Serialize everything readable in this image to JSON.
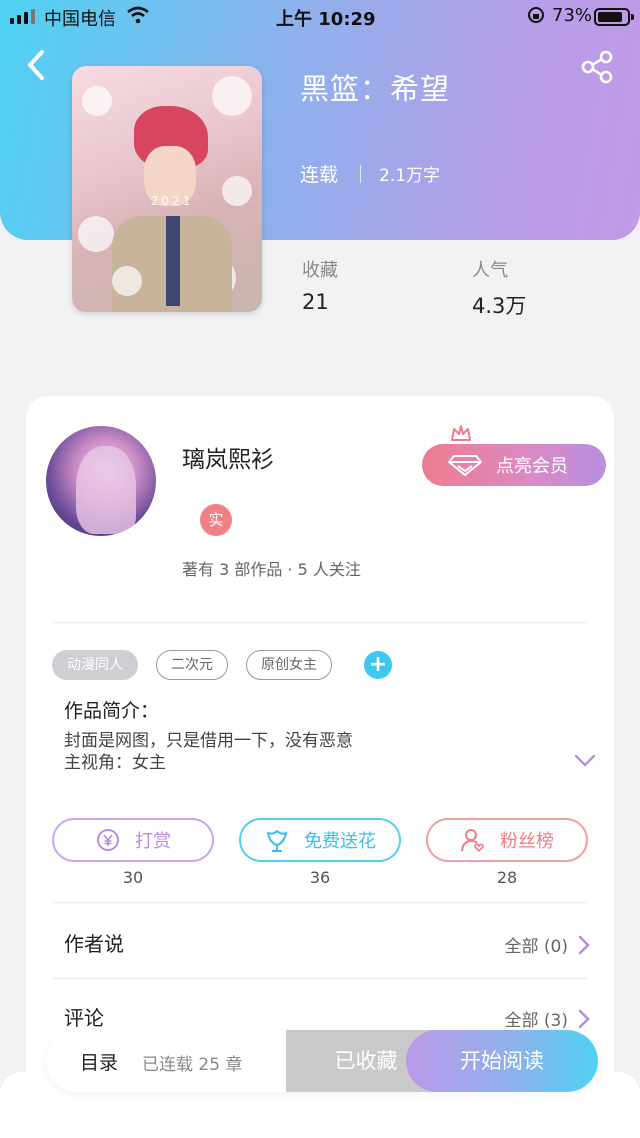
{
  "status_bar": {
    "carrier": "中国电信",
    "time": "上午 10:29",
    "battery": "73%"
  },
  "book": {
    "title": "黑篮：希望",
    "state": "连载",
    "words": "2.1万字",
    "cover_watermark": "2021",
    "stats": [
      {
        "label": "收藏",
        "value": "21"
      },
      {
        "label": "人气",
        "value": "4.3万"
      }
    ]
  },
  "author": {
    "name": "璃岚熙衫",
    "badge": "实",
    "summary": "著有 3 部作品 · 5 人关注",
    "vip_label": "点亮会员"
  },
  "tags": [
    "动漫同人",
    "二次元",
    "原创女主"
  ],
  "tag_add": "+",
  "intro": {
    "heading": "作品简介：",
    "lines": [
      "封面是网图，只是借用一下，没有恶意",
      "主视角：女主"
    ]
  },
  "actions": [
    {
      "label": "打赏",
      "count": "30",
      "icon": "yen-icon",
      "color": "#b98be0"
    },
    {
      "label": "免费送花",
      "count": "36",
      "icon": "flower-icon",
      "color": "#46c8ee"
    },
    {
      "label": "粉丝榜",
      "count": "28",
      "icon": "fan-icon",
      "color": "#ef7d84"
    }
  ],
  "sections": [
    {
      "label": "作者说",
      "link": "全部 (0)"
    },
    {
      "label": "评论",
      "link": "全部 (3)"
    }
  ],
  "bottom_bar": {
    "toc_label": "目录",
    "chapters": "已连载 25 章",
    "saved_label": "已收藏",
    "read_label": "开始阅读"
  }
}
